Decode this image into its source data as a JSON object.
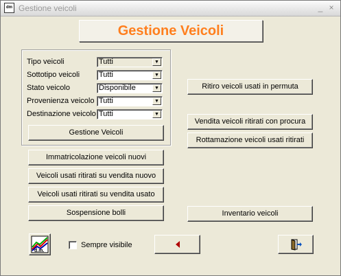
{
  "window": {
    "title": "Gestione veicoli",
    "controls": {
      "minimize": "_",
      "close": "×"
    }
  },
  "header": {
    "title": "Gestione Veicoli",
    "title_color": "#ff7f1e"
  },
  "filters": [
    {
      "label": "Tipo veicoli",
      "value": "Tutti",
      "disabled": true
    },
    {
      "label": "Sottotipo veicoli",
      "value": "Tutti",
      "disabled": false
    },
    {
      "label": "Stato veicolo",
      "value": "Disponibile",
      "disabled": false
    },
    {
      "label": "Provenienza veicolo",
      "value": "Tutti",
      "disabled": false
    },
    {
      "label": "Destinazione veicolo",
      "value": "Tutti",
      "disabled": false
    }
  ],
  "buttons": {
    "gestione_veicoli": "Gestione Veicoli",
    "immatricolazione": "Immatricolazione veicoli nuovi",
    "usati_vendita_nuovo": "Veicoli usati ritirati su vendita nuovo",
    "usati_vendita_usato": "Veicoli usati ritirati su vendita usato",
    "sospensione_bolli": "Sospensione bolli",
    "ritiro_permuta": "Ritiro veicoli usati in permuta",
    "vendita_procura": "Vendita veicoli ritirati con procura",
    "rottamazione": "Rottamazione veicoli usati ritirati",
    "inventario": "Inventario veicoli"
  },
  "footer": {
    "checkbox_label": "Sempre visibile",
    "checkbox_checked": false,
    "logo_icon": "app-logo-icon",
    "back_icon": "back-arrow-icon",
    "exit_icon": "exit-door-icon",
    "back_arrow_color": "#b00000"
  }
}
